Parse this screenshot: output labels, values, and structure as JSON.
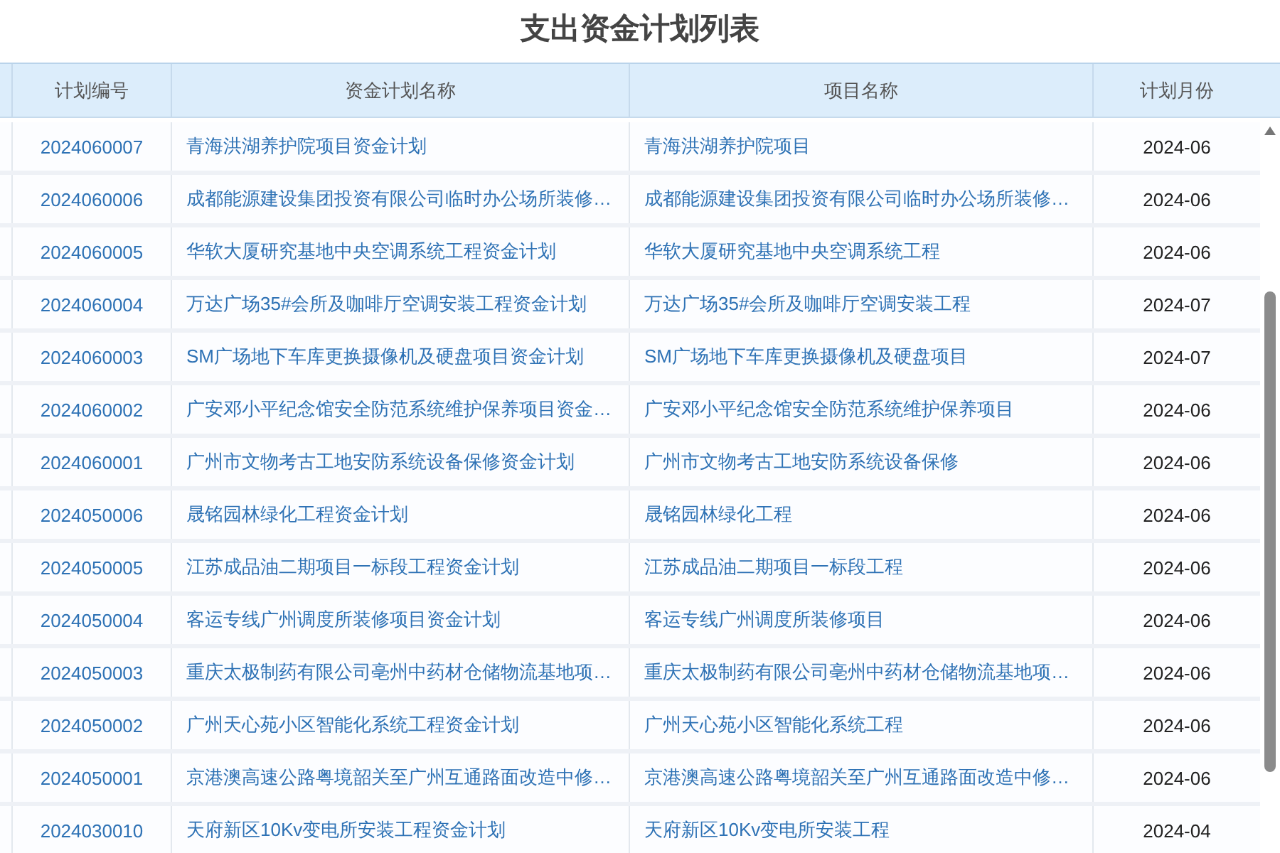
{
  "title": "支出资金计划列表",
  "table": {
    "columns": [
      "计划编号",
      "资金计划名称",
      "项目名称",
      "计划月份"
    ],
    "rows": [
      [
        "2024060007",
        "青海洪湖养护院项目资金计划",
        "青海洪湖养护院项目",
        "2024-06"
      ],
      [
        "2024060006",
        "成都能源建设集团投资有限公司临时办公场所装修…",
        "成都能源建设集团投资有限公司临时办公场所装修…",
        "2024-06"
      ],
      [
        "2024060005",
        "华软大厦研究基地中央空调系统工程资金计划",
        "华软大厦研究基地中央空调系统工程",
        "2024-06"
      ],
      [
        "2024060004",
        "万达广场35#会所及咖啡厅空调安装工程资金计划",
        "万达广场35#会所及咖啡厅空调安装工程",
        "2024-07"
      ],
      [
        "2024060003",
        "SM广场地下车库更换摄像机及硬盘项目资金计划",
        "SM广场地下车库更换摄像机及硬盘项目",
        "2024-07"
      ],
      [
        "2024060002",
        "广安邓小平纪念馆安全防范系统维护保养项目资金…",
        "广安邓小平纪念馆安全防范系统维护保养项目",
        "2024-06"
      ],
      [
        "2024060001",
        "广州市文物考古工地安防系统设备保修资金计划",
        "广州市文物考古工地安防系统设备保修",
        "2024-06"
      ],
      [
        "2024050006",
        "晟铭园林绿化工程资金计划",
        "晟铭园林绿化工程",
        "2024-06"
      ],
      [
        "2024050005",
        "江苏成品油二期项目一标段工程资金计划",
        "江苏成品油二期项目一标段工程",
        "2024-06"
      ],
      [
        "2024050004",
        "客运专线广州调度所装修项目资金计划",
        "客运专线广州调度所装修项目",
        "2024-06"
      ],
      [
        "2024050003",
        "重庆太极制药有限公司亳州中药材仓储物流基地项…",
        "重庆太极制药有限公司亳州中药材仓储物流基地项…",
        "2024-06"
      ],
      [
        "2024050002",
        "广州天心苑小区智能化系统工程资金计划",
        "广州天心苑小区智能化系统工程",
        "2024-06"
      ],
      [
        "2024050001",
        "京港澳高速公路粤境韶关至广州互通路面改造中修…",
        "京港澳高速公路粤境韶关至广州互通路面改造中修…",
        "2024-06"
      ],
      [
        "2024030010",
        "天府新区10Kv变电所安装工程资金计划",
        "天府新区10Kv变电所安装工程",
        "2024-04"
      ]
    ]
  }
}
